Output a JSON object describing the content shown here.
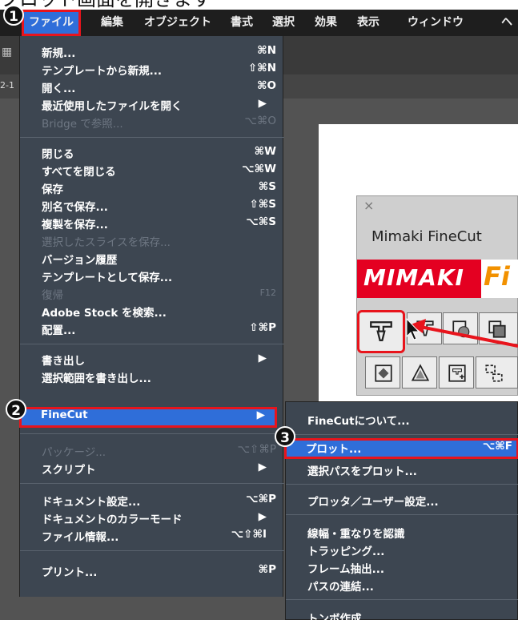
{
  "caption": "プロット画面を開きます",
  "menubar": {
    "items": [
      "ファイル",
      "編集",
      "オブジェクト",
      "書式",
      "選択",
      "効果",
      "表示",
      "ウィンドウ",
      "ヘ"
    ]
  },
  "tab_text": "2-1",
  "steps": [
    "1",
    "2",
    "3"
  ],
  "file_menu": {
    "items": [
      {
        "label": "新規...",
        "shortcut": "⌘N"
      },
      {
        "label": "テンプレートから新規...",
        "shortcut": "⇧⌘N"
      },
      {
        "label": "開く...",
        "shortcut": "⌘O"
      },
      {
        "label": "最近使用したファイルを開く",
        "shortcut": "▶"
      },
      {
        "label": "Bridge で参照...",
        "shortcut": "⌥⌘O"
      },
      {
        "label": "閉じる",
        "shortcut": "⌘W"
      },
      {
        "label": "すべてを閉じる",
        "shortcut": "⌥⌘W"
      },
      {
        "label": "保存",
        "shortcut": "⌘S"
      },
      {
        "label": "別名で保存...",
        "shortcut": "⇧⌘S"
      },
      {
        "label": "複製を保存...",
        "shortcut": "⌥⌘S"
      },
      {
        "label": "選択したスライスを保存...",
        "shortcut": ""
      },
      {
        "label": "バージョン履歴",
        "shortcut": ""
      },
      {
        "label": "テンプレートとして保存...",
        "shortcut": ""
      },
      {
        "label": "復帰",
        "shortcut": "F12"
      },
      {
        "label": "Adobe Stock を検索...",
        "shortcut": ""
      },
      {
        "label": "配置...",
        "shortcut": "⇧⌘P"
      },
      {
        "label": "書き出し",
        "shortcut": "▶"
      },
      {
        "label": "選択範囲を書き出し...",
        "shortcut": ""
      },
      {
        "label": "FineCut",
        "shortcut": "▶"
      },
      {
        "label": "パッケージ...",
        "shortcut": "⌥⇧⌘P"
      },
      {
        "label": "スクリプト",
        "shortcut": "▶"
      },
      {
        "label": "ドキュメント設定...",
        "shortcut": "⌥⌘P"
      },
      {
        "label": "ドキュメントのカラーモード",
        "shortcut": "▶"
      },
      {
        "label": "ファイル情報...",
        "shortcut": "⌥⇧⌘I"
      },
      {
        "label": "プリント...",
        "shortcut": "⌘P"
      }
    ]
  },
  "finecut_submenu": {
    "items": [
      {
        "label": "FineCutについて...",
        "shortcut": ""
      },
      {
        "label": "プロット...",
        "shortcut": "⌥⌘F"
      },
      {
        "label": "選択パスをプロット...",
        "shortcut": ""
      },
      {
        "label": "プロッタ／ユーザー設定...",
        "shortcut": ""
      },
      {
        "label": "線幅・重なりを認識",
        "shortcut": ""
      },
      {
        "label": "トラッピング...",
        "shortcut": ""
      },
      {
        "label": "フレーム抽出...",
        "shortcut": ""
      },
      {
        "label": "パスの連結...",
        "shortcut": ""
      },
      {
        "label": "トンボ作成...",
        "shortcut": ""
      }
    ]
  },
  "panel": {
    "close": "×",
    "title": "Mimaki FineCut",
    "logo": "MIMAKI",
    "logo_fi": "Fi"
  },
  "colors": {
    "highlight_border": "#e8141c",
    "selection_blue": "#2f6ed9",
    "menu_bg": "#3d4651",
    "logo_red": "#e40021"
  }
}
